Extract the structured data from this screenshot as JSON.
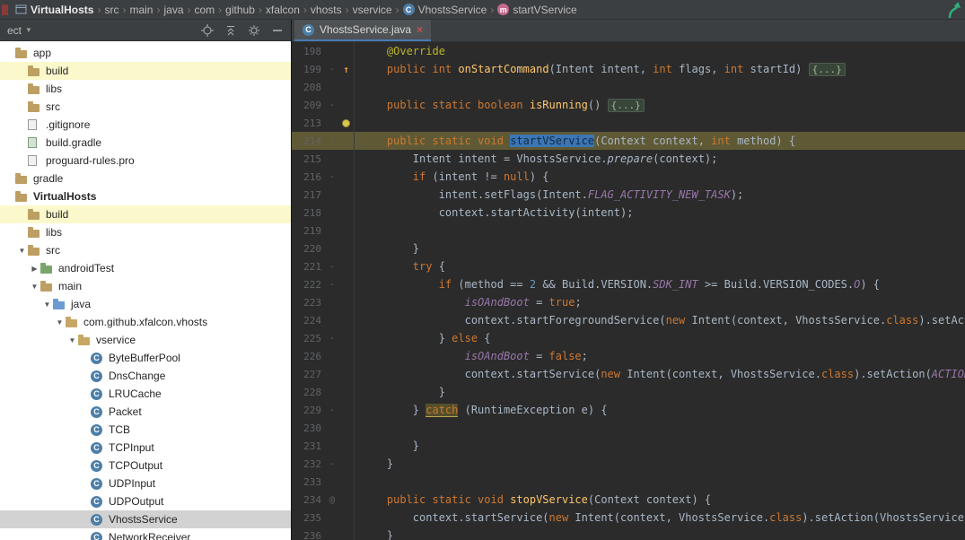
{
  "colors": {
    "chrome_bg": "#3c3f41",
    "editor_bg": "#2b2b2b",
    "caret_line": "#5f5a35",
    "selection": "#3c76b5",
    "tree_selected_bg": "#d2d2d2",
    "excluded_bg": "#fbf8cc",
    "keyword": "#cc7832",
    "annotation": "#bbb529",
    "method_decl": "#ffc66d",
    "constant": "#9876aa",
    "number": "#6897bb"
  },
  "breadcrumbs": {
    "separator": "›",
    "items": [
      {
        "label": "VirtualHosts",
        "icon": "module-icon",
        "bold": true
      },
      {
        "label": "src"
      },
      {
        "label": "main"
      },
      {
        "label": "java"
      },
      {
        "label": "com"
      },
      {
        "label": "github"
      },
      {
        "label": "xfalcon"
      },
      {
        "label": "vhosts"
      },
      {
        "label": "vservice"
      },
      {
        "label": "VhostsService",
        "icon": "class-icon"
      },
      {
        "label": "startVService",
        "icon": "method-icon"
      }
    ]
  },
  "panel": {
    "title": "ect",
    "icons": [
      "locate-icon",
      "collapse-all-icon",
      "settings-gear-icon",
      "hide-panel-icon"
    ]
  },
  "project_tree": {
    "items": [
      {
        "label": "app",
        "indent": 0,
        "icon": "folder"
      },
      {
        "label": "build",
        "indent": 1,
        "icon": "folder",
        "bg": "yellow"
      },
      {
        "label": "libs",
        "indent": 1,
        "icon": "folder"
      },
      {
        "label": "src",
        "indent": 1,
        "icon": "folder"
      },
      {
        "label": ".gitignore",
        "indent": 1,
        "icon": "file"
      },
      {
        "label": "build.gradle",
        "indent": 1,
        "icon": "gradle"
      },
      {
        "label": "proguard-rules.pro",
        "indent": 1,
        "icon": "file"
      },
      {
        "label": "gradle",
        "indent": 0,
        "icon": "folder"
      },
      {
        "label": "VirtualHosts",
        "indent": 0,
        "icon": "folder",
        "bold": true
      },
      {
        "label": "build",
        "indent": 1,
        "icon": "folder",
        "bg": "yellow"
      },
      {
        "label": "libs",
        "indent": 1,
        "icon": "folder"
      },
      {
        "label": "src",
        "indent": 1,
        "icon": "folder",
        "arrow": "down"
      },
      {
        "label": "androidTest",
        "indent": 2,
        "icon": "folder-green",
        "arrow": "right"
      },
      {
        "label": "main",
        "indent": 2,
        "icon": "folder",
        "arrow": "down"
      },
      {
        "label": "java",
        "indent": 3,
        "icon": "folder-blue",
        "arrow": "down"
      },
      {
        "label": "com.github.xfalcon.vhosts",
        "indent": 4,
        "icon": "package",
        "arrow": "down"
      },
      {
        "label": "vservice",
        "indent": 5,
        "icon": "package",
        "arrow": "down"
      },
      {
        "label": "ByteBufferPool",
        "indent": 6,
        "icon": "class"
      },
      {
        "label": "DnsChange",
        "indent": 6,
        "icon": "class"
      },
      {
        "label": "LRUCache",
        "indent": 6,
        "icon": "class"
      },
      {
        "label": "Packet",
        "indent": 6,
        "icon": "class"
      },
      {
        "label": "TCB",
        "indent": 6,
        "icon": "class"
      },
      {
        "label": "TCPInput",
        "indent": 6,
        "icon": "class"
      },
      {
        "label": "TCPOutput",
        "indent": 6,
        "icon": "class"
      },
      {
        "label": "UDPInput",
        "indent": 6,
        "icon": "class"
      },
      {
        "label": "UDPOutput",
        "indent": 6,
        "icon": "class"
      },
      {
        "label": "VhostsService",
        "indent": 6,
        "icon": "class",
        "bg": "selected"
      },
      {
        "label": "NetworkReceiver",
        "indent": 6,
        "icon": "class"
      }
    ]
  },
  "editor": {
    "tab": {
      "label": "VhostsService.java"
    },
    "lines": [
      {
        "num": 198,
        "tokens": [
          [
            "p",
            "    "
          ],
          [
            "a",
            "@Override"
          ]
        ]
      },
      {
        "num": 199,
        "icon": "override",
        "mark": "-",
        "tokens": [
          [
            "p",
            "    "
          ],
          [
            "k",
            "public"
          ],
          [
            "p",
            " "
          ],
          [
            "k",
            "int"
          ],
          [
            "p",
            " "
          ],
          [
            "m",
            "onStartCommand"
          ],
          [
            "p",
            "(Intent intent, "
          ],
          [
            "k",
            "int"
          ],
          [
            "p",
            " flags, "
          ],
          [
            "k",
            "int"
          ],
          [
            "p",
            " startId) "
          ],
          [
            "fold",
            "{...}"
          ]
        ]
      },
      {
        "num": 208,
        "tokens": []
      },
      {
        "num": 209,
        "mark": "-",
        "tokens": [
          [
            "p",
            "    "
          ],
          [
            "k",
            "public static boolean"
          ],
          [
            "p",
            " "
          ],
          [
            "m",
            "isRunning"
          ],
          [
            "p",
            "() "
          ],
          [
            "fold",
            "{...}"
          ]
        ]
      },
      {
        "num": 213,
        "icon": "bulb",
        "tokens": []
      },
      {
        "num": 214,
        "cur": true,
        "mark": "-",
        "tokens": [
          [
            "p",
            "    "
          ],
          [
            "k",
            "public static void"
          ],
          [
            "p",
            " "
          ],
          [
            "sel",
            "startVService"
          ],
          [
            "p",
            "(Context context, "
          ],
          [
            "k",
            "int"
          ],
          [
            "p",
            " method) {"
          ]
        ]
      },
      {
        "num": 215,
        "tokens": [
          [
            "p",
            "        Intent intent = VhostsService."
          ],
          [
            "s",
            "prepare"
          ],
          [
            "p",
            "(context);"
          ]
        ]
      },
      {
        "num": 216,
        "mark": "-",
        "tokens": [
          [
            "p",
            "        "
          ],
          [
            "k",
            "if"
          ],
          [
            "p",
            " (intent != "
          ],
          [
            "k",
            "null"
          ],
          [
            "p",
            ") {"
          ]
        ]
      },
      {
        "num": 217,
        "tokens": [
          [
            "p",
            "            intent.setFlags(Intent."
          ],
          [
            "f",
            "FLAG_ACTIVITY_NEW_TASK"
          ],
          [
            "p",
            ");"
          ]
        ]
      },
      {
        "num": 218,
        "tokens": [
          [
            "p",
            "            context.startActivity(intent);"
          ]
        ]
      },
      {
        "num": 219,
        "tokens": []
      },
      {
        "num": 220,
        "tokens": [
          [
            "p",
            "        }"
          ]
        ]
      },
      {
        "num": 221,
        "mark": "-",
        "tokens": [
          [
            "p",
            "        "
          ],
          [
            "k",
            "try"
          ],
          [
            "p",
            " {"
          ]
        ]
      },
      {
        "num": 222,
        "mark": "-",
        "tokens": [
          [
            "p",
            "            "
          ],
          [
            "k",
            "if"
          ],
          [
            "p",
            " (method == "
          ],
          [
            "n",
            "2"
          ],
          [
            "p",
            " && Build.VERSION."
          ],
          [
            "f",
            "SDK_INT"
          ],
          [
            "p",
            " >= Build.VERSION_CODES."
          ],
          [
            "f",
            "O"
          ],
          [
            "p",
            ") {"
          ]
        ]
      },
      {
        "num": 223,
        "tokens": [
          [
            "p",
            "                "
          ],
          [
            "f",
            "isOAndBoot"
          ],
          [
            "p",
            " = "
          ],
          [
            "k",
            "true"
          ],
          [
            "p",
            ";"
          ]
        ]
      },
      {
        "num": 224,
        "tokens": [
          [
            "p",
            "                context.startForegroundService("
          ],
          [
            "k",
            "new"
          ],
          [
            "p",
            " Intent(context, VhostsService."
          ],
          [
            "k",
            "class"
          ],
          [
            "p",
            ").setAction("
          ]
        ]
      },
      {
        "num": 225,
        "mark": "-",
        "tokens": [
          [
            "p",
            "            } "
          ],
          [
            "k",
            "else"
          ],
          [
            "p",
            " {"
          ]
        ]
      },
      {
        "num": 226,
        "tokens": [
          [
            "p",
            "                "
          ],
          [
            "f",
            "isOAndBoot"
          ],
          [
            "p",
            " = "
          ],
          [
            "k",
            "false"
          ],
          [
            "p",
            ";"
          ]
        ]
      },
      {
        "num": 227,
        "tokens": [
          [
            "p",
            "                context.startService("
          ],
          [
            "k",
            "new"
          ],
          [
            "p",
            " Intent(context, VhostsService."
          ],
          [
            "k",
            "class"
          ],
          [
            "p",
            ").setAction("
          ],
          [
            "f",
            "ACTION_CON"
          ]
        ]
      },
      {
        "num": 228,
        "tokens": [
          [
            "p",
            "            }"
          ]
        ]
      },
      {
        "num": 229,
        "mark": "-",
        "tokens": [
          [
            "p",
            "        } "
          ],
          [
            "warn",
            "catch"
          ],
          [
            "p",
            " (RuntimeException e) {"
          ]
        ]
      },
      {
        "num": 230,
        "tokens": []
      },
      {
        "num": 231,
        "tokens": [
          [
            "p",
            "        }"
          ]
        ]
      },
      {
        "num": 232,
        "mark": "-",
        "tokens": [
          [
            "p",
            "    }"
          ]
        ]
      },
      {
        "num": 233,
        "tokens": []
      },
      {
        "num": 234,
        "mark": "@",
        "tokens": [
          [
            "p",
            "    "
          ],
          [
            "k",
            "public static void"
          ],
          [
            "p",
            " "
          ],
          [
            "m",
            "stopVService"
          ],
          [
            "p",
            "(Context context) {"
          ]
        ]
      },
      {
        "num": 235,
        "tokens": [
          [
            "p",
            "        context.startService("
          ],
          [
            "k",
            "new"
          ],
          [
            "p",
            " Intent(context, VhostsService."
          ],
          [
            "k",
            "class"
          ],
          [
            "p",
            ").setAction(VhostsService."
          ],
          [
            "f",
            "ACTI"
          ]
        ]
      },
      {
        "num": 236,
        "tokens": [
          [
            "p",
            "    }"
          ]
        ]
      }
    ]
  }
}
